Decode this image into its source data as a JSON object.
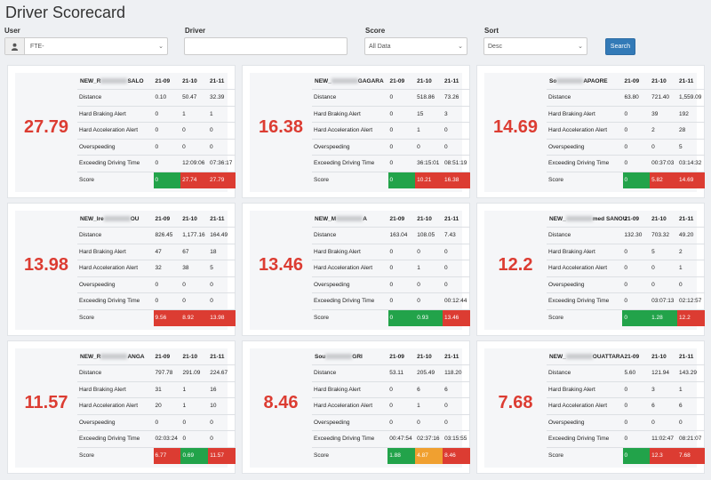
{
  "page": {
    "title": "Driver Scorecard"
  },
  "filters": {
    "user_label": "User",
    "user_value": "FTE-",
    "driver_label": "Driver",
    "driver_value": "",
    "score_label": "Score",
    "score_value": "All Data",
    "sort_label": "Sort",
    "sort_value": "Desc",
    "search_label": "Search"
  },
  "columns": [
    "21-09",
    "21-10",
    "21-11"
  ],
  "metric_labels": [
    "Distance",
    "Hard Braking Alert",
    "Hard Acceleration Alert",
    "Overspeeding",
    "Exceeding Driving Time",
    "Score"
  ],
  "colors": {
    "red": "#dc3c32",
    "green": "#22a34a",
    "orange": "#f0a030"
  },
  "cards": [
    {
      "name_start": "NEW_R",
      "name_end": "SALO",
      "score": "27.79",
      "rows": [
        [
          "0.10",
          "50.47",
          "32.39"
        ],
        [
          "0",
          "1",
          "1"
        ],
        [
          "0",
          "0",
          "0"
        ],
        [
          "0",
          "0",
          "0"
        ],
        [
          "0",
          "12:09:06",
          "07:36:17"
        ]
      ],
      "scores": [
        "0",
        "27.74",
        "27.79"
      ],
      "score_colors": [
        "green",
        "red",
        "red"
      ]
    },
    {
      "name_start": "NEW_",
      "name_end": "GAGARA",
      "score": "16.38",
      "rows": [
        [
          "0",
          "518.86",
          "73.26"
        ],
        [
          "0",
          "15",
          "3"
        ],
        [
          "0",
          "1",
          "0"
        ],
        [
          "0",
          "0",
          "0"
        ],
        [
          "0",
          "36:15:01",
          "08:51:19"
        ]
      ],
      "scores": [
        "0",
        "10.21",
        "16.38"
      ],
      "score_colors": [
        "green",
        "red",
        "red"
      ]
    },
    {
      "name_start": "So",
      "name_end": "APAORE",
      "score": "14.69",
      "rows": [
        [
          "63.80",
          "721.40",
          "1,559.09"
        ],
        [
          "0",
          "39",
          "192"
        ],
        [
          "0",
          "2",
          "28"
        ],
        [
          "0",
          "0",
          "5"
        ],
        [
          "0",
          "00:37:03",
          "03:14:32"
        ]
      ],
      "scores": [
        "0",
        "5.82",
        "14.69"
      ],
      "score_colors": [
        "green",
        "red",
        "red"
      ]
    },
    {
      "name_start": "NEW_Ire",
      "name_end": "OU",
      "score": "13.98",
      "rows": [
        [
          "826.45",
          "1,177.16",
          "164.49"
        ],
        [
          "47",
          "67",
          "18"
        ],
        [
          "32",
          "38",
          "5"
        ],
        [
          "0",
          "0",
          "0"
        ],
        [
          "0",
          "0",
          "0"
        ]
      ],
      "scores": [
        "9.56",
        "8.92",
        "13.98"
      ],
      "score_colors": [
        "red",
        "red",
        "red"
      ]
    },
    {
      "name_start": "NEW_M",
      "name_end": "A",
      "score": "13.46",
      "rows": [
        [
          "163.04",
          "108.05",
          "7.43"
        ],
        [
          "0",
          "0",
          "0"
        ],
        [
          "0",
          "1",
          "0"
        ],
        [
          "0",
          "0",
          "0"
        ],
        [
          "0",
          "0",
          "00:12:44"
        ]
      ],
      "scores": [
        "0",
        "0.93",
        "13.46"
      ],
      "score_colors": [
        "green",
        "green",
        "red"
      ]
    },
    {
      "name_start": "NEW_",
      "name_end": "med SANOU",
      "score": "12.2",
      "rows": [
        [
          "132.30",
          "703.32",
          "49.20"
        ],
        [
          "0",
          "5",
          "2"
        ],
        [
          "0",
          "0",
          "1"
        ],
        [
          "0",
          "0",
          "0"
        ],
        [
          "0",
          "03:07:13",
          "02:12:57"
        ]
      ],
      "scores": [
        "0",
        "1.28",
        "12.2"
      ],
      "score_colors": [
        "green",
        "green",
        "red"
      ]
    },
    {
      "name_start": "NEW_R",
      "name_end": "ANGA",
      "score": "11.57",
      "rows": [
        [
          "797.78",
          "291.09",
          "224.67"
        ],
        [
          "31",
          "1",
          "16"
        ],
        [
          "20",
          "1",
          "10"
        ],
        [
          "0",
          "0",
          "0"
        ],
        [
          "02:03:24",
          "0",
          "0"
        ]
      ],
      "scores": [
        "6.77",
        "0.69",
        "11.57"
      ],
      "score_colors": [
        "red",
        "green",
        "red"
      ]
    },
    {
      "name_start": "Sou",
      "name_end": "GRI",
      "score": "8.46",
      "rows": [
        [
          "53.11",
          "205.49",
          "118.20"
        ],
        [
          "0",
          "6",
          "6"
        ],
        [
          "0",
          "1",
          "0"
        ],
        [
          "0",
          "0",
          "0"
        ],
        [
          "00:47:54",
          "02:37:16",
          "03:15:55"
        ]
      ],
      "scores": [
        "1.88",
        "4.87",
        "8.46"
      ],
      "score_colors": [
        "green",
        "orange",
        "red"
      ]
    },
    {
      "name_start": "NEW_",
      "name_end": "OUATTARA",
      "score": "7.68",
      "rows": [
        [
          "5.60",
          "121.94",
          "143.29"
        ],
        [
          "0",
          "3",
          "1"
        ],
        [
          "0",
          "6",
          "6"
        ],
        [
          "0",
          "0",
          "0"
        ],
        [
          "0",
          "11:02:47",
          "08:21:07"
        ]
      ],
      "scores": [
        "0",
        "12.3",
        "7.68"
      ],
      "score_colors": [
        "green",
        "red",
        "red"
      ]
    }
  ]
}
